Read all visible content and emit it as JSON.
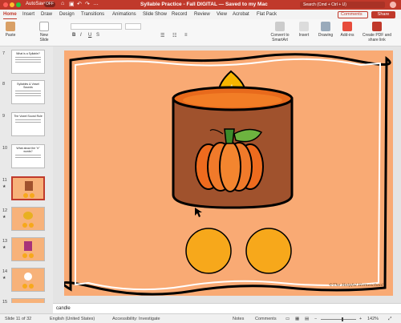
{
  "titlebar": {
    "autosave_label": "AutoSave",
    "autosave_state": "OFF",
    "title": "Syllable Practice - Fall DIGITAL — Saved to my Mac",
    "search_placeholder": "Search (Cmd + Ctrl + U)"
  },
  "tabs": [
    "Home",
    "Insert",
    "Draw",
    "Design",
    "Transitions",
    "Animations",
    "Slide Show",
    "Record",
    "Review",
    "View",
    "Acrobat",
    "Flat Pack"
  ],
  "header_buttons": {
    "comments": "Comments",
    "share": "Share"
  },
  "ribbon": {
    "paste": "Paste",
    "new_slide": "New Slide",
    "convert": "Convert to SmartArt",
    "insert": "Insert",
    "drawing": "Drawing",
    "addins": "Add-ins",
    "create_pdf": "Create PDF and share link"
  },
  "slides": [
    {
      "num": "7",
      "title": "What is a Syllable?"
    },
    {
      "num": "8",
      "title": "Syllables & Vowel Sounds"
    },
    {
      "num": "9",
      "title": "The Vowel Sound Rule"
    },
    {
      "num": "10",
      "title": "What about the \"e\" words?"
    },
    {
      "num": "11",
      "title": ""
    },
    {
      "num": "12",
      "title": ""
    },
    {
      "num": "13",
      "title": ""
    },
    {
      "num": "14",
      "title": ""
    },
    {
      "num": "15",
      "title": ""
    }
  ],
  "slide_content": {
    "watermark": "©The Helpful Homeschool"
  },
  "notes": "candle",
  "statusbar": {
    "slide_of": "Slide 11 of 32",
    "language": "English (United States)",
    "accessibility": "Accessibility: Investigate",
    "notes": "Notes",
    "comments": "Comments",
    "zoom": "142%"
  },
  "colors": {
    "accent": "#c0392b",
    "slide_bg": "#f9aa74",
    "candle": "#a0522d",
    "circle": "#f7a81b"
  }
}
